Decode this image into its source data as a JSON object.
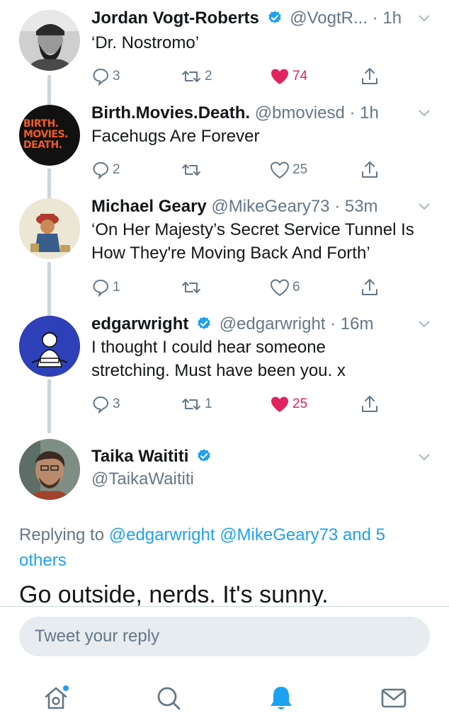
{
  "colors": {
    "accent": "#1da1f2",
    "like": "#e0245e",
    "muted": "#657786",
    "thread_line": "#ccd6dd",
    "input_bg": "#e6ecf0"
  },
  "tweets": [
    {
      "name": "Jordan Vogt-Roberts",
      "verified": true,
      "handle": "@VogtR...",
      "dot": "·",
      "time": "1h",
      "text": "‘Dr. Nostromo’",
      "replies": "3",
      "retweets": "2",
      "likes": "74",
      "liked": true
    },
    {
      "name": "Birth.Movies.Death.",
      "verified": false,
      "handle": "@bmoviesd",
      "dot": "·",
      "time": "1h",
      "text": "Facehugs Are Forever",
      "replies": "2",
      "retweets": "",
      "likes": "25",
      "liked": false,
      "avatar_text": [
        "BIRTH.",
        "MOVIES.",
        "DEATH."
      ]
    },
    {
      "name": "Michael Geary",
      "verified": false,
      "handle": "@MikeGeary73",
      "dot": "·",
      "time": "53m",
      "text": "‘On Her Majesty’s Secret Service Tunnel Is How They're Moving Back And Forth’",
      "replies": "1",
      "retweets": "",
      "likes": "6",
      "liked": false
    },
    {
      "name": "edgarwright",
      "verified": true,
      "handle": "@edgarwright",
      "dot": "·",
      "time": "16m",
      "text": "I thought I could hear someone stretching. Must have been you. x",
      "replies": "3",
      "retweets": "1",
      "likes": "25",
      "liked": true
    }
  ],
  "focused": {
    "name": "Taika Waititi",
    "verified": true,
    "handle": "@TaikaWaititi",
    "replying_prefix": "Replying to",
    "replying_to": [
      "@edgarwright",
      "@MikeGeary73"
    ],
    "replying_more": "and 5 others",
    "text": "Go outside, nerds. It's sunny."
  },
  "reply_box": {
    "placeholder": "Tweet your reply"
  },
  "tabbar": {
    "icons": [
      "home-icon",
      "search-icon",
      "notifications-bell-icon",
      "messages-envelope-icon"
    ],
    "active": "notifications-bell-icon",
    "home_has_dot": true
  }
}
